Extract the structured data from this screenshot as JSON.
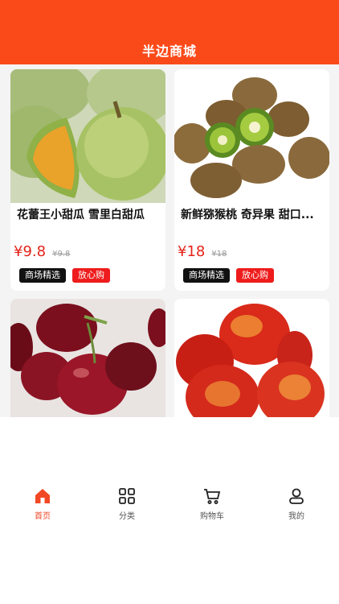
{
  "header": {
    "title": "半边商城"
  },
  "products": [
    {
      "name": "花蕾王小甜瓜 雪里白甜瓜",
      "price": "¥9.8",
      "old_price": "¥9.8",
      "tags": [
        "商场精选",
        "放心购"
      ]
    },
    {
      "name": "新鲜猕猴桃 奇异果 甜口...",
      "price": "¥18",
      "old_price": "¥18",
      "tags": [
        "商场精选",
        "放心购"
      ]
    },
    {
      "name": "",
      "price": "",
      "old_price": "",
      "tags": []
    },
    {
      "name": "",
      "price": "",
      "old_price": "",
      "tags": []
    }
  ],
  "tabbar": {
    "items": [
      {
        "label": "首页",
        "icon": "home-icon",
        "active": true
      },
      {
        "label": "分类",
        "icon": "grid-icon",
        "active": false
      },
      {
        "label": "购物车",
        "icon": "cart-icon",
        "active": false
      },
      {
        "label": "我的",
        "icon": "person-icon",
        "active": false
      }
    ]
  },
  "colors": {
    "brand": "#fb4a1a",
    "price": "#e4231b",
    "tag_red": "#ee1c1c",
    "tag_dark": "#111111",
    "tab_active": "#f24724"
  }
}
